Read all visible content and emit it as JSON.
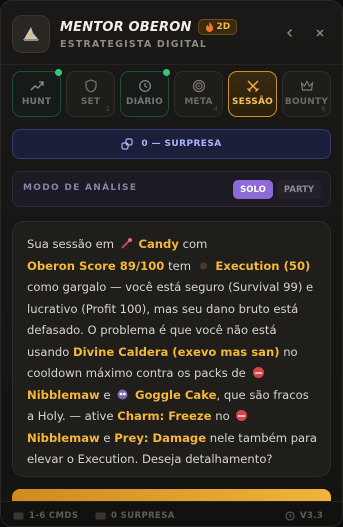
{
  "header": {
    "title": "MENTOR OBERON",
    "badge": "2D",
    "subtitle": "ESTRATEGISTA DIGITAL",
    "back_icon": "chevron-left-icon",
    "close_icon": "close-icon"
  },
  "tabs": [
    {
      "label": "HUNT",
      "icon": "trending-up-icon",
      "state": "done",
      "num": ""
    },
    {
      "label": "SET",
      "icon": "shield-icon",
      "state": "idle",
      "num": "2"
    },
    {
      "label": "DIÁRIO",
      "icon": "history-icon",
      "state": "done",
      "num": ""
    },
    {
      "label": "META",
      "icon": "target-icon",
      "state": "idle",
      "num": "4"
    },
    {
      "label": "SESSÃO",
      "icon": "crossed-swords-icon",
      "state": "active",
      "num": ""
    },
    {
      "label": "BOUNTY",
      "icon": "crown-icon",
      "state": "idle",
      "num": "6"
    }
  ],
  "surprise": {
    "label": "0 — SURPRESA"
  },
  "mode": {
    "label": "MODO DE ANÁLISE",
    "solo": "SOLO",
    "party": "PARTY"
  },
  "message": {
    "t1": "Sua sessão em",
    "h1": "Candy",
    "t2": "com",
    "h2": "Oberon Score 89/100",
    "t3": "tem",
    "h3": "Execution (50)",
    "t4": "como gargalo — você está seguro (Survival 99) e lucrativo (Profit 100), mas seu dano bruto está defasado. O problema é que você não está usando",
    "h4": "Divine Caldera (exevo mas san)",
    "t5": "no cooldown máximo contra os packs de",
    "h5": "Nibblemaw",
    "t6": "e",
    "h6": "Goggle Cake",
    "t7": ", que são fracos a Holy. — ative",
    "h7": "Charm: Freeze",
    "t8": "no",
    "h8": "Nibblemaw",
    "t9": "e",
    "h9": "Prey: Damage",
    "t10": "nele também para elevar o Execution. Deseja detalhamento?"
  },
  "footer": {
    "cmds": "1-6 CMDS",
    "surprise": "0 SURPRESA",
    "version": "V3.3"
  },
  "colors": {
    "accent": "#f5b63a",
    "success": "#34c77b",
    "indigo": "#a9b3f5",
    "purple": "#8e6ad8"
  }
}
